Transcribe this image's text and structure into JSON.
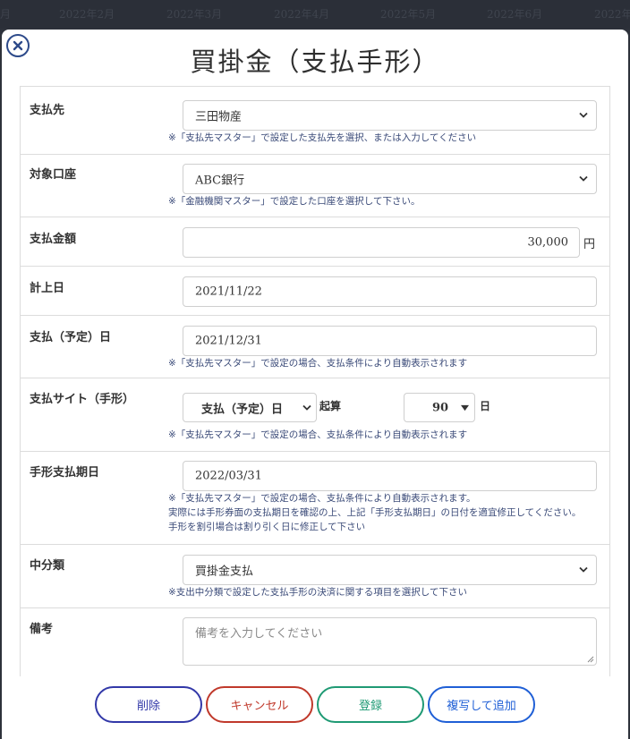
{
  "background": {
    "months": [
      "月",
      "2022年2月",
      "2022年3月",
      "2022年4月",
      "2022年5月",
      "2022年6月",
      "2022年"
    ]
  },
  "modal": {
    "title": "買掛金（支払手形）",
    "close_icon": "close-circle-icon"
  },
  "form": {
    "payee": {
      "label": "支払先",
      "value": "三田物産",
      "hint": "※「支払先マスター」で設定した支払先を選択、または入力してください"
    },
    "account": {
      "label": "対象口座",
      "value": "ABC銀行",
      "hint": "※「金融機関マスター」で設定した口座を選択して下さい。"
    },
    "amount": {
      "label": "支払金額",
      "value": "30,000",
      "unit": "円"
    },
    "posting_date": {
      "label": "計上日",
      "value": "2021/11/22"
    },
    "payment_date": {
      "label": "支払（予定）日",
      "value": "2021/12/31",
      "hint": "※「支払先マスター」で設定の場合、支払条件により自動表示されます"
    },
    "payment_site": {
      "label": "支払サイト（手形）",
      "base_value": "支払（予定）日",
      "base_suffix": "起算",
      "days_value": "90",
      "days_unit": "日",
      "hint": "※「支払先マスター」で設定の場合、支払条件により自動表示されます"
    },
    "due_date": {
      "label": "手形支払期日",
      "value": "2022/03/31",
      "hint_lines": [
        "※「支払先マスター」で設定の場合、支払条件により自動表示されます。",
        "実際には手形券面の支払期日を確認の上、上記「手形支払期日」の日付を適宜修正してください。",
        "手形を割引場合は割り引く日に修正して下さい"
      ]
    },
    "category": {
      "label": "中分類",
      "value": "買掛金支払",
      "hint": "※支出中分類で設定した支払手形の決済に関する項目を選択して下さい"
    },
    "memo": {
      "label": "備考",
      "placeholder": "備考を入力してください"
    }
  },
  "buttons": {
    "delete": "削除",
    "cancel": "キャンセル",
    "register": "登録",
    "copy_add": "複写して追加"
  },
  "colors": {
    "delete": "#3238a8",
    "cancel": "#c0392b",
    "register": "#1f9a74",
    "copy_add": "#1f5fd6",
    "hint_text": "#3a4a78"
  }
}
